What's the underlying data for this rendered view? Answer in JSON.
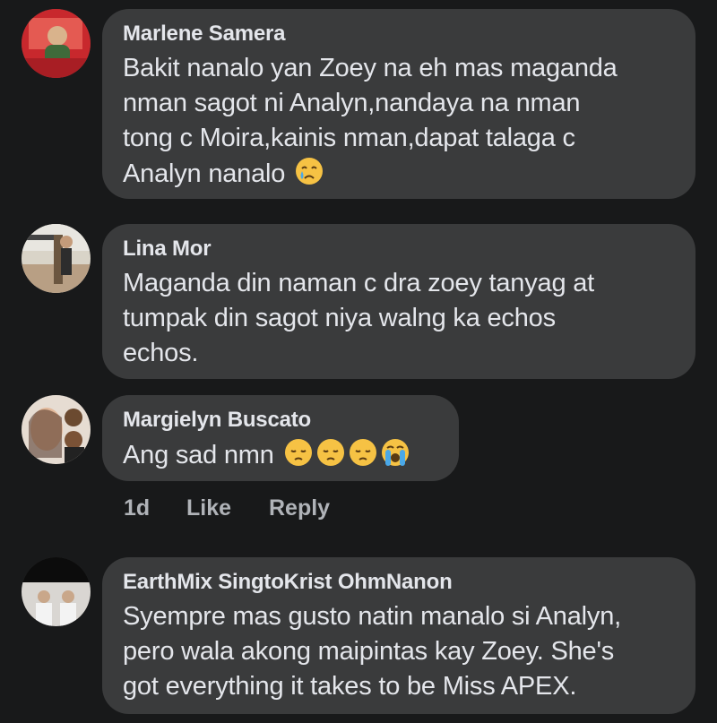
{
  "comments": [
    {
      "author": "Marlene Samera",
      "text": "Bakit nanalo yan Zoey na eh mas maganda\nnman sagot ni Analyn,nandaya na nman\ntong c Moira,kainis nman,dapat talaga c\nAnalyn nanalo",
      "emoji": [
        "crying-face-emoji"
      ]
    },
    {
      "author": "Lina Mor",
      "text": "Maganda din naman c dra zoey tanyag at\ntumpak din sagot niya walng ka echos\nechos.",
      "emoji": []
    },
    {
      "author": "Margielyn Buscato",
      "text": "Ang sad nmn",
      "emoji": [
        "pensive-face-emoji",
        "pensive-face-emoji",
        "pensive-face-emoji",
        "loudly-crying-face-emoji"
      ]
    },
    {
      "author": "EarthMix SingtoKrist OhmNanon",
      "text": "Syempre mas gusto natin manalo si Analyn,\npero wala akong maipintas kay Zoey. She's\ngot everything it takes to be Miss APEX.",
      "emoji": []
    }
  ],
  "actions": {
    "time": "1d",
    "like": "Like",
    "reply": "Reply"
  },
  "colors": {
    "background": "#18191a",
    "bubble": "#3a3b3c",
    "text": "#e4e6eb",
    "secondary_text": "#b0b3b8"
  }
}
